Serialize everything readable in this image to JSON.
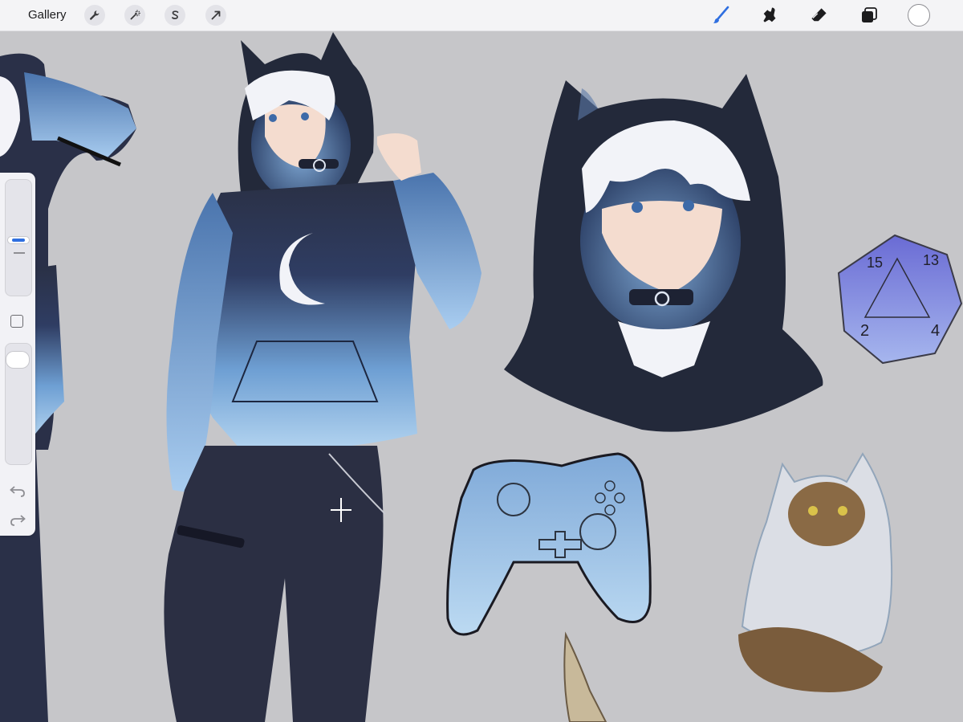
{
  "topbar": {
    "gallery_label": "Gallery",
    "left_tools": [
      "wrench-icon",
      "magic-wand-icon",
      "selection-s-icon",
      "transform-arrow-icon"
    ],
    "right_tools": [
      "brush-icon",
      "smudge-icon",
      "eraser-icon",
      "layers-icon"
    ],
    "active_color": "#ffffff",
    "accent_color": "#2f6fe0"
  },
  "sidebar": {
    "brush_size_level": 0.48,
    "opacity_level": 0.08,
    "icons": [
      "modify-square-icon",
      "undo-icon",
      "redo-icon"
    ]
  },
  "canvas": {
    "background": "#c6c6c9",
    "artwork": [
      "character-fullbody-partial-left",
      "character-fullbody-hoodie",
      "character-bust-portrait",
      "d20-dice-sticker",
      "game-controller-sticker",
      "cat-raincoat-sticker",
      "fish-bones-sketch"
    ]
  }
}
